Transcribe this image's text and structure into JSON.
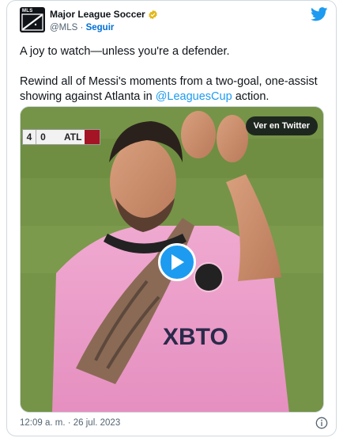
{
  "author": {
    "name": "Major League Soccer",
    "handle": "@MLS",
    "separator": "·",
    "follow_label": "Seguir",
    "avatar_text": "MLS"
  },
  "tweet": {
    "line1": "A joy to watch—unless you're a defender.",
    "line2_before": "Rewind all of Messi's moments from a two-goal, one-assist showing against Atlanta in ",
    "mention": "@LeaguesCup",
    "line2_after": " action."
  },
  "media": {
    "view_label": "Ver en Twitter",
    "scoreboard": {
      "home_score": "4",
      "away_score": "0",
      "away_team": "ATL"
    },
    "jersey_text": "XBTO"
  },
  "footer": {
    "timestamp": "12:09 a. m. · 26 jul. 2023"
  },
  "colors": {
    "follow": "#006fd6",
    "mention": "#1d9bf0",
    "play_button": "#1d9bf0",
    "twitter_brand": "#1d9bf0",
    "verified": "#e2b719",
    "atl_red": "#a41425"
  },
  "icons": {
    "logo": "twitter-bird-icon",
    "verified": "gold-verified-icon",
    "play": "play-icon",
    "info": "info-icon"
  }
}
